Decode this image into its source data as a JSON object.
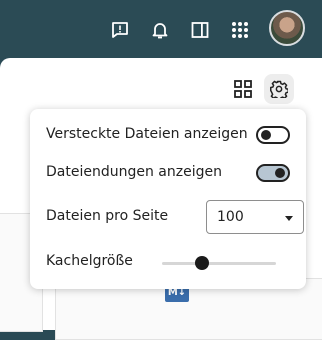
{
  "topbar": {
    "icons": [
      "feedback-icon",
      "bell-icon",
      "sidebar-toggle-icon",
      "apps-grid-icon"
    ],
    "avatar": "user-avatar"
  },
  "toolbar": {
    "view_icon": "grid-view-icon",
    "settings_icon": "gear-icon"
  },
  "settings_menu": {
    "show_hidden_label": "Versteckte Dateien anzeigen",
    "show_hidden_on": false,
    "show_ext_label": "Dateiendungen anzeigen",
    "show_ext_on": true,
    "per_page_label": "Dateien pro Seite",
    "per_page_value": "100",
    "tile_size_label": "Kachelgröße",
    "tile_size_level": 0.35
  },
  "content": {
    "file_badge": "M↓"
  },
  "colors": {
    "topbar": "#2b4b55",
    "toggle_on_bg": "#b7c6d2",
    "file_icon": "#3a6dab"
  }
}
